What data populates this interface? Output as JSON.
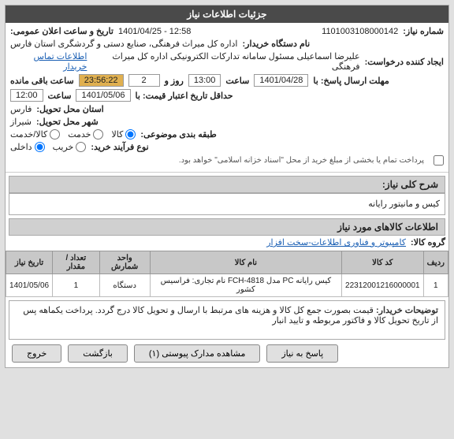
{
  "header": {
    "title": "جزئیات اطلاعات نیاز"
  },
  "fields": {
    "shomara_niaz_label": "شماره نیاز:",
    "shomara_niaz_value": "1101003108000142",
    "nam_dastgah_label": "نام دستگاه خریدار:",
    "nam_dastgah_value": "اداره کل میراث فرهنگی، صنایع دستی و گردشگری استان فارس",
    "ijad_konandeh_label": "ایجاد کننده درخواست:",
    "ijad_konandeh_name": "علیرضا اسماعیلی مسئول سامانه تدارکات الکترونیکی اداره کل میراث فرهنگی",
    "ijad_konandeh_link": "اطلاعات تماس خریدار",
    "mohlat_label": "مهلت ارسال پاسخ: با",
    "mohlat_date": "1401/04/28",
    "mohlat_time_label": "ساعت",
    "mohlat_time": "13:00",
    "mohlat_rooz_label": "روز و",
    "mohlat_rooz_value": "2",
    "mohlat_mande_label": "ساعت باقی مانده",
    "mohlat_mande_value": "23:56:22",
    "hadaqal_label": "حداقل تاریخ اعتبار قیمت: با",
    "hadaqal_date": "1401/05/06",
    "hadaqal_time_label": "ساعت",
    "hadaqal_time": "12:00",
    "ostan_label": "استان محل تحویل:",
    "ostan_value": "فارس",
    "shahr_label": "شهر محل تحویل:",
    "shahr_value": "شیراز",
    "tabaqe_label": "طبقه بندی موضوعی:",
    "tabaqe_kala": "کالا",
    "tabaqe_khadamat": "خدمت",
    "tabaqe_kala_khadamat": "کالا/خدمت",
    "tabaqe_selected": "kala",
    "nooe_farayand_label": "نوع فرآیند خرید:",
    "nooe_gharib": "خریب",
    "nooe_daakheli": "داخلی",
    "nooe_selected": "daakheli",
    "payment_note": "پرداخت تمام یا بخشی از مبلغ خرید از محل \"اسناد خزانه اسلامی\" خواهد بود.",
    "date_announce": "1401/04/25 - 12:58",
    "date_announce_label": "تاریخ و ساعت اعلان عمومی:"
  },
  "description": {
    "section_title": "شرح کلی نیاز:",
    "value": "کیس و مانیتور رایانه"
  },
  "items_info": {
    "section_title": "اطلاعات کالاهای مورد نیاز",
    "group_label": "گروه کالا:",
    "group_value": "کامپیوتر و فناوری اطلاعات-سخت افزار",
    "table": {
      "columns": [
        "ردیف",
        "کد کالا",
        "نام کالا",
        "واحد شمارش",
        "تعداد / مقدار",
        "تاریخ نیاز"
      ],
      "rows": [
        {
          "radif": "1",
          "kod_kala": "22312001216000001",
          "nam_kala": "کیس رایانه PC مدل FCH-4818 نام تجاری: فراسیس کشور",
          "vahed": "دستگاه",
          "tedad": "1",
          "tarikh": "1401/05/06"
        }
      ]
    }
  },
  "notes": {
    "label": "توضیحات خریدار:",
    "text": "قیمت بصورت جمع کل کالا و هزینه های مرتبط با ارسال و تحویل کالا درج گردد. پرداخت یکماهه پس از تاریخ تحویل کالا و فاکتور مربوطه و تایید انبار"
  },
  "buttons": {
    "pasokh_label": "پاسخ به نیاز",
    "moshahedeh_label": "مشاهده مدارک پیوستی (۱)",
    "bazgasht_label": "بازگشت",
    "khorooj_label": "خروج"
  }
}
